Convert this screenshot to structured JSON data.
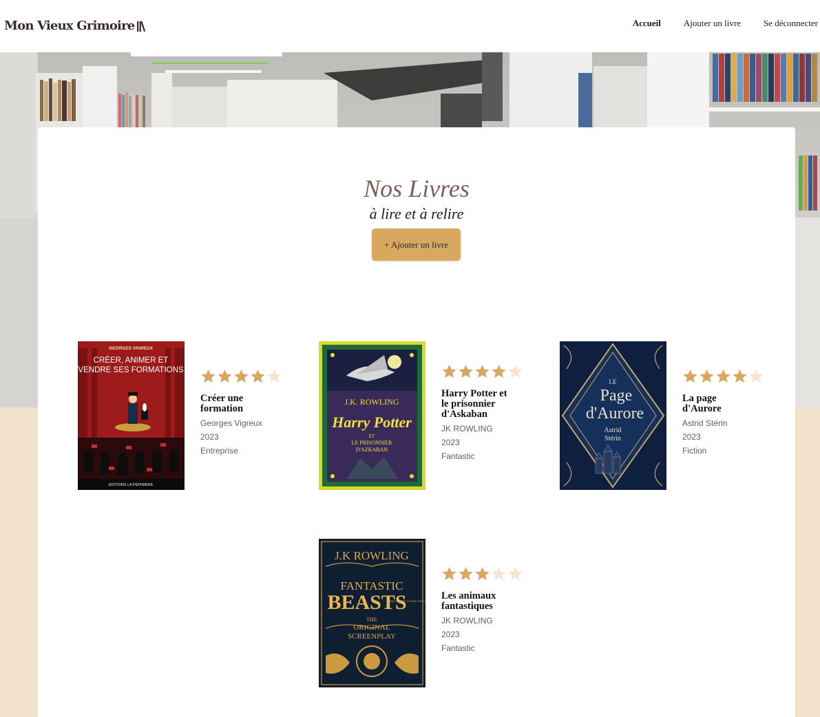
{
  "header": {
    "logo_text": "Mon Vieux Grimoire",
    "nav": [
      {
        "label": "Accueil",
        "active": true
      },
      {
        "label": "Ajouter un livre",
        "active": false
      },
      {
        "label": "Se déconnecter",
        "active": false
      }
    ]
  },
  "main": {
    "title": "Nos Livres",
    "subtitle": "à lire et à relire",
    "add_button_label": "+ Ajouter un livre"
  },
  "colors": {
    "accent": "#d9a860",
    "beige_background": "#f2e2cc",
    "title": "#7b5f5c",
    "star_filled": "#d9a860",
    "star_empty": "#f4e6d3"
  },
  "books": [
    {
      "title": "Créer une formation",
      "author": "Georges Vigreux",
      "year": "2023",
      "genre": "Entreprise",
      "rating": 4,
      "max_rating": 5,
      "cover": {
        "top_text": "GEORGES VIGREUX",
        "title_lines": [
          "CRÉER, ANIMER ET",
          "VENDRE SES FORMATIONS"
        ],
        "bottom_text": "EDITIONS LA PÉPINIÈRE"
      }
    },
    {
      "title": "Harry Potter et le prisonnier d'Askaban",
      "author": "JK ROWLING",
      "year": "2023",
      "genre": "Fantastic",
      "rating": 4,
      "max_rating": 5,
      "cover": {
        "top_text": "J.K. ROWLING",
        "title_lines": [
          "Harry Potter"
        ],
        "sub_lines": [
          "ET",
          "LE PRISONNIER",
          "D'AZKABAN"
        ]
      }
    },
    {
      "title": "La page d'Aurore",
      "author": "Astrid Stérin",
      "year": "2023",
      "genre": "Fiction",
      "rating": 4,
      "max_rating": 5,
      "cover": {
        "title_lines": [
          "LE",
          "Page",
          "d'Aurore"
        ],
        "author_lines": [
          "Astrid",
          "Stérin"
        ]
      }
    },
    {
      "title": "Les animaux fantastiques",
      "author": "JK ROWLING",
      "year": "2023",
      "genre": "Fantastic",
      "rating": 3,
      "max_rating": 5,
      "cover": {
        "top_text": "J.K ROWLING",
        "title_lines": [
          "FANTASTIC",
          "BEASTS"
        ],
        "small_text": "AND WHERE TO FIND THEM",
        "sub_lines": [
          "THE",
          "ORIGINAL",
          "SCREENPLAY"
        ]
      }
    }
  ]
}
